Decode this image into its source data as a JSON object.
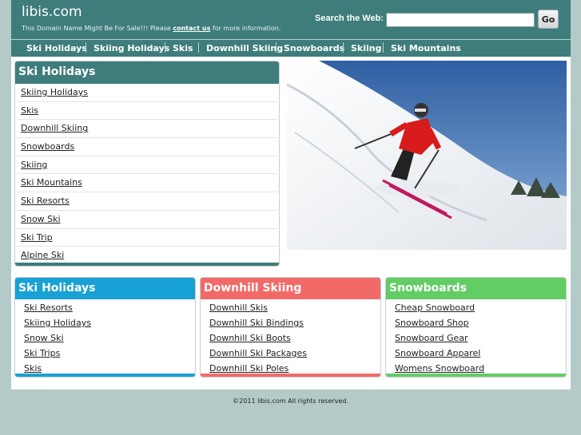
{
  "header": {
    "site_title": "libis.com",
    "tagline_prefix": "This Domain Name Might Be For Sale!!! Please ",
    "tagline_link": "contact us",
    "tagline_suffix": " for more information.",
    "search_label": "Search the Web:",
    "search_value": "",
    "go_label": "Go"
  },
  "nav": {
    "items": [
      "Ski Holidays",
      "Skiing Holidays",
      "Skis",
      "Downhill Skiing",
      "Snowboards",
      "Skiing",
      "Ski Mountains"
    ]
  },
  "main_box": {
    "title": "Ski Holidays",
    "links": [
      "Skiing Holidays",
      "Skis",
      "Downhill Skiing",
      "Snowboards",
      "Skiing",
      "Ski Mountains",
      "Ski Resorts",
      "Snow Ski",
      "Ski Trip",
      "Alpine Ski"
    ]
  },
  "columns": [
    {
      "title": "Ski Holidays",
      "color": "#17a1d4",
      "links": [
        "Ski Resorts",
        "Skiing Holidays",
        "Snow Ski",
        "Ski Trips",
        "Skis"
      ]
    },
    {
      "title": "Downhill Skiing",
      "color": "#f26a68",
      "links": [
        "Downhill Skis",
        "Downhill Ski Bindings",
        "Downhill Ski Boots",
        "Downhill Ski Packages",
        "Downhill Ski Poles"
      ]
    },
    {
      "title": "Snowboards",
      "color": "#62cd65",
      "links": [
        "Cheap Snowboard",
        "Snowboard Shop",
        "Snowboard Gear",
        "Snowboard Apparel",
        "Womens Snowboard"
      ]
    }
  ],
  "footer": {
    "text": "©2011 libis.com All rights reserved."
  },
  "colors": {
    "accent": "#3e7d7c",
    "background": "#b3cac8"
  }
}
